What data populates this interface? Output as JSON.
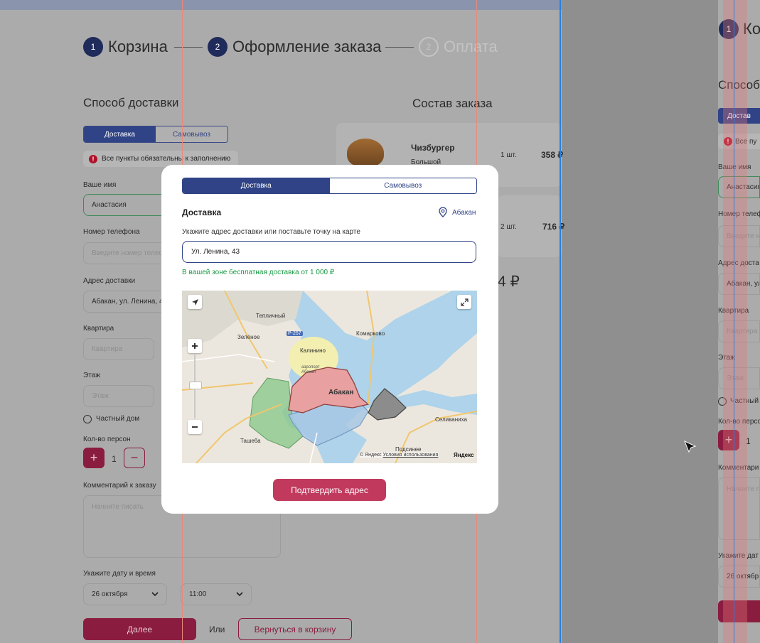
{
  "steps": [
    {
      "num": "1",
      "label": "Корзина"
    },
    {
      "num": "2",
      "label": "Оформление заказа"
    },
    {
      "num": "2",
      "label": "Оплата"
    }
  ],
  "delivery_method": {
    "title": "Способ доставки",
    "tabs": [
      "Доставка",
      "Самовывоз"
    ],
    "alert": "Все пункты обязательны к заполнению"
  },
  "form": {
    "name_label": "Ваше имя",
    "name_value": "Анастасия",
    "phone_label": "Номер телефона",
    "phone_placeholder": "Введите номер телефона",
    "address_label": "Адрес доставки",
    "address_value": "Абакан, ул. Ленина, 43",
    "apartment_label": "Квартира",
    "apartment_placeholder": "Квартира",
    "floor_label": "Этаж",
    "floor_placeholder": "Этаж",
    "private_house": "Частный дом",
    "persons_label": "Кол-во персон",
    "persons_plus": "+",
    "persons_count": "1",
    "persons_minus": "−",
    "comment_label": "Комментарий к заказу",
    "comment_placeholder": "Начните писать",
    "datetime_label": "Укажите дату и время",
    "date_value": "26 октября",
    "time_value": "11:00",
    "next_button": "Далее",
    "or_text": "Или",
    "back_button": "Вернуться в корзину"
  },
  "order": {
    "title": "Состав заказа",
    "items": [
      {
        "name": "Чизбургер",
        "desc": "Большой",
        "qty": "1 шт.",
        "price": "358 ₽"
      },
      {
        "qty": "2 шт.",
        "price": "716 ₽"
      }
    ],
    "total_fragment": "4 ₽"
  },
  "modal": {
    "tabs": [
      "Доставка",
      "Самовывоз"
    ],
    "title": "Доставка",
    "city": "Абакан",
    "hint": "Укажите адрес доставки или поставьте точку на карте",
    "address_value": "Ул. Ленина, 43",
    "free_delivery": "В вашей зоне бесплатная доставка от 1 000 ₽",
    "confirm_button": "Подтвердить адрес",
    "map": {
      "labels": [
        "Тепличный",
        "Зелёное",
        "Р-257",
        "Калинино",
        "аэропорт Абакан",
        "Абакан",
        "Комарково",
        "Селиваниха",
        "Ташеба",
        "Подсинее"
      ],
      "copyright": "© Яндекс",
      "terms": "Условия использования",
      "brand": "Яндекс"
    }
  },
  "right_frame": {
    "step_num": "1",
    "step_label": "Ко",
    "title": "Способ",
    "tab": "Достав",
    "alert": "Все пу",
    "name_label": "Ваше имя",
    "name_value": "Анастасия",
    "phone_label": "Номер телеф",
    "phone_placeholder": "Введите н",
    "address_label": "Адрес доста",
    "address_value": "Абакан, ул",
    "apartment_label": "Квартира",
    "apartment_placeholder": "Квартира",
    "floor_label": "Этаж",
    "floor_placeholder": "Этаж",
    "private_house": "Частный",
    "persons_label": "Кол-во персо",
    "persons_count": "1",
    "comment_label": "Комментари",
    "comment_placeholder": "Начните п",
    "datetime_label": "Укажите дат",
    "date_value": "26 октябр"
  },
  "colors": {
    "accent": "#2f4386",
    "brand": "#c13a5e",
    "success": "#1a9a44",
    "error": "#b0122a"
  }
}
